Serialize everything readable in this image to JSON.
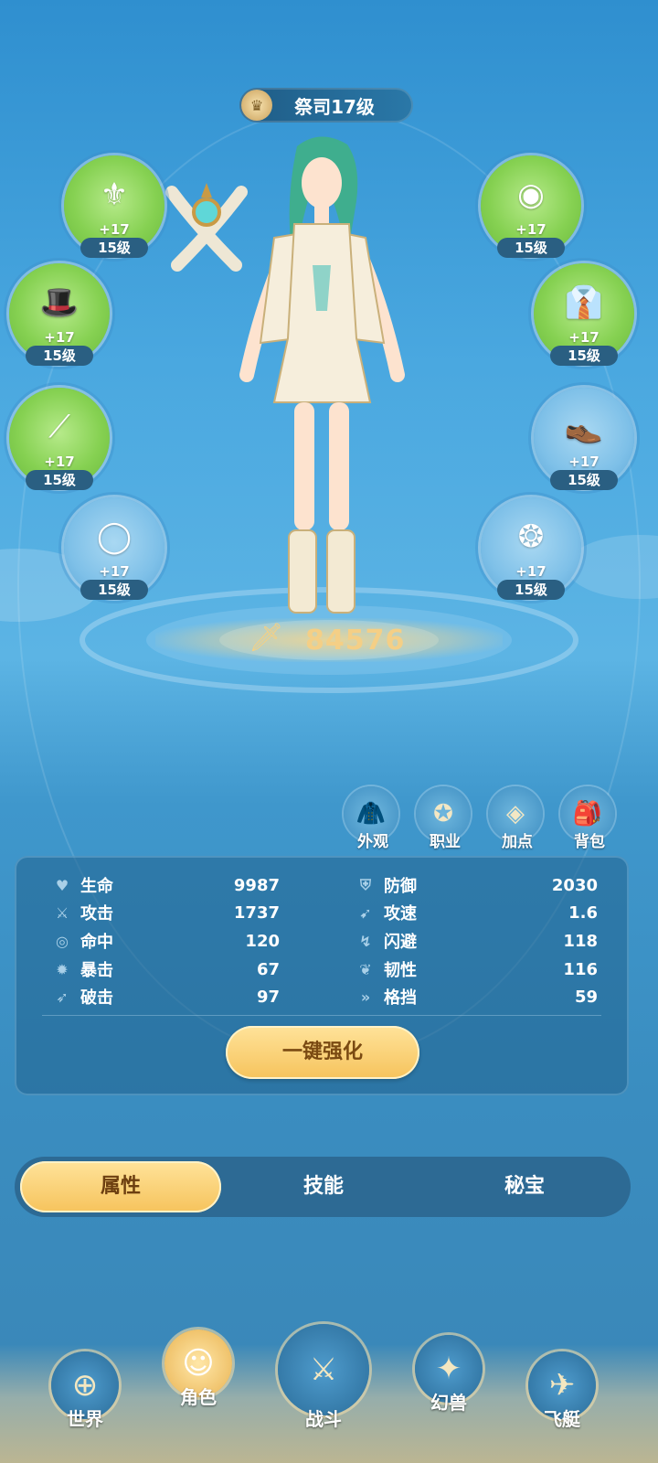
{
  "rank": {
    "title": "祭司17级"
  },
  "equipment_left": [
    {
      "icon": "crossbow-icon",
      "plus": "+17",
      "level": "15级"
    },
    {
      "icon": "hat-icon",
      "plus": "+17",
      "level": "15级"
    },
    {
      "icon": "bracer-icon",
      "plus": "+17",
      "level": "15级"
    },
    {
      "icon": "ring-icon",
      "plus": "+17",
      "level": "15级"
    }
  ],
  "equipment_right": [
    {
      "icon": "orb-icon",
      "plus": "+17",
      "level": "15级"
    },
    {
      "icon": "jacket-icon",
      "plus": "+17",
      "level": "15级"
    },
    {
      "icon": "shoes-icon",
      "plus": "+17",
      "level": "15级"
    },
    {
      "icon": "necklace-icon",
      "plus": "+17",
      "level": "15级"
    }
  ],
  "power": {
    "value": "84576"
  },
  "menu": [
    {
      "label": "外观",
      "icon": "outfit-icon"
    },
    {
      "label": "职业",
      "icon": "class-icon"
    },
    {
      "label": "加点",
      "icon": "points-icon"
    },
    {
      "label": "背包",
      "icon": "bag-icon"
    }
  ],
  "stats_left": [
    {
      "name": "生命",
      "value": "9987",
      "icon": "heart-icon"
    },
    {
      "name": "攻击",
      "value": "1737",
      "icon": "swords-icon"
    },
    {
      "name": "命中",
      "value": "120",
      "icon": "target-icon"
    },
    {
      "name": "暴击",
      "value": "67",
      "icon": "crit-icon"
    },
    {
      "name": "破击",
      "value": "97",
      "icon": "pierce-icon"
    }
  ],
  "stats_right": [
    {
      "name": "防御",
      "value": "2030",
      "icon": "shield-icon"
    },
    {
      "name": "攻速",
      "value": "1.6",
      "icon": "speed-icon"
    },
    {
      "name": "闪避",
      "value": "118",
      "icon": "dodge-icon"
    },
    {
      "name": "韧性",
      "value": "116",
      "icon": "toughness-icon"
    },
    {
      "name": "格挡",
      "value": "59",
      "icon": "block-icon"
    }
  ],
  "enhance_button": "一键强化",
  "tabs": [
    {
      "label": "属性",
      "active": true
    },
    {
      "label": "技能",
      "active": false
    },
    {
      "label": "秘宝",
      "active": false
    }
  ],
  "bottom_nav": [
    {
      "label": "世界",
      "icon": "world-icon"
    },
    {
      "label": "角色",
      "icon": "character-icon",
      "active": true
    },
    {
      "label": "战斗",
      "icon": "battle-sword-icon"
    },
    {
      "label": "幻兽",
      "icon": "beast-icon"
    },
    {
      "label": "飞艇",
      "icon": "airship-icon"
    }
  ]
}
